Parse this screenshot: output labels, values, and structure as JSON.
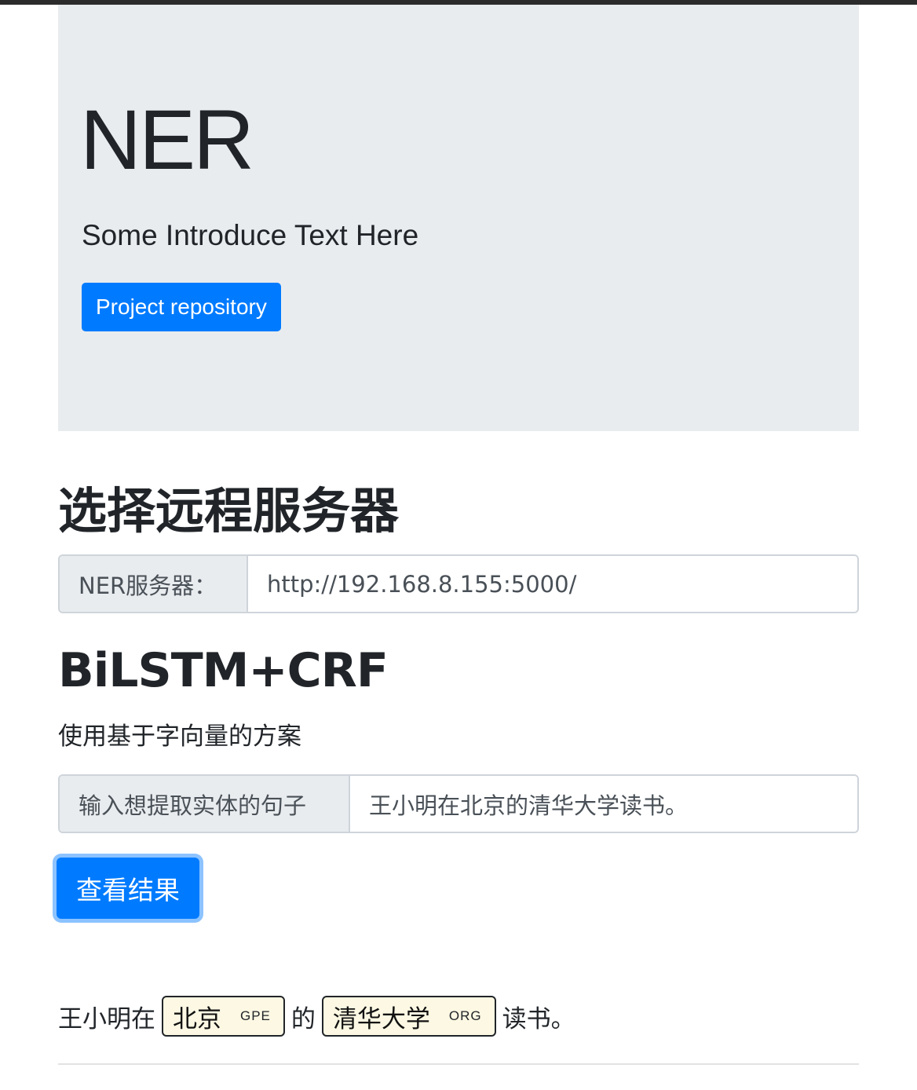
{
  "jumbotron": {
    "title": "NER",
    "lead": "Some Introduce Text Here",
    "button_label": "Project repository"
  },
  "server_section": {
    "title": "选择远程服务器",
    "field_label": "NER服务器：",
    "field_value": "http://192.168.8.155:5000/"
  },
  "model_section": {
    "title": "BiLSTM+CRF",
    "description": "使用基于字向量的方案",
    "input_label": "输入想提取实体的句子",
    "input_value": "王小明在北京的清华大学读书。",
    "submit_label": "查看结果"
  },
  "result": {
    "text_1": "王小明在",
    "entity_1": {
      "text": "北京",
      "tag": "GPE"
    },
    "text_2": "的",
    "entity_2": {
      "text": "清华大学",
      "tag": "ORG"
    },
    "text_3": "读书。"
  },
  "colors": {
    "primary": "#007bff",
    "jumbotron_bg": "#e9ecef",
    "entity_bg": "#fcf8e3"
  }
}
